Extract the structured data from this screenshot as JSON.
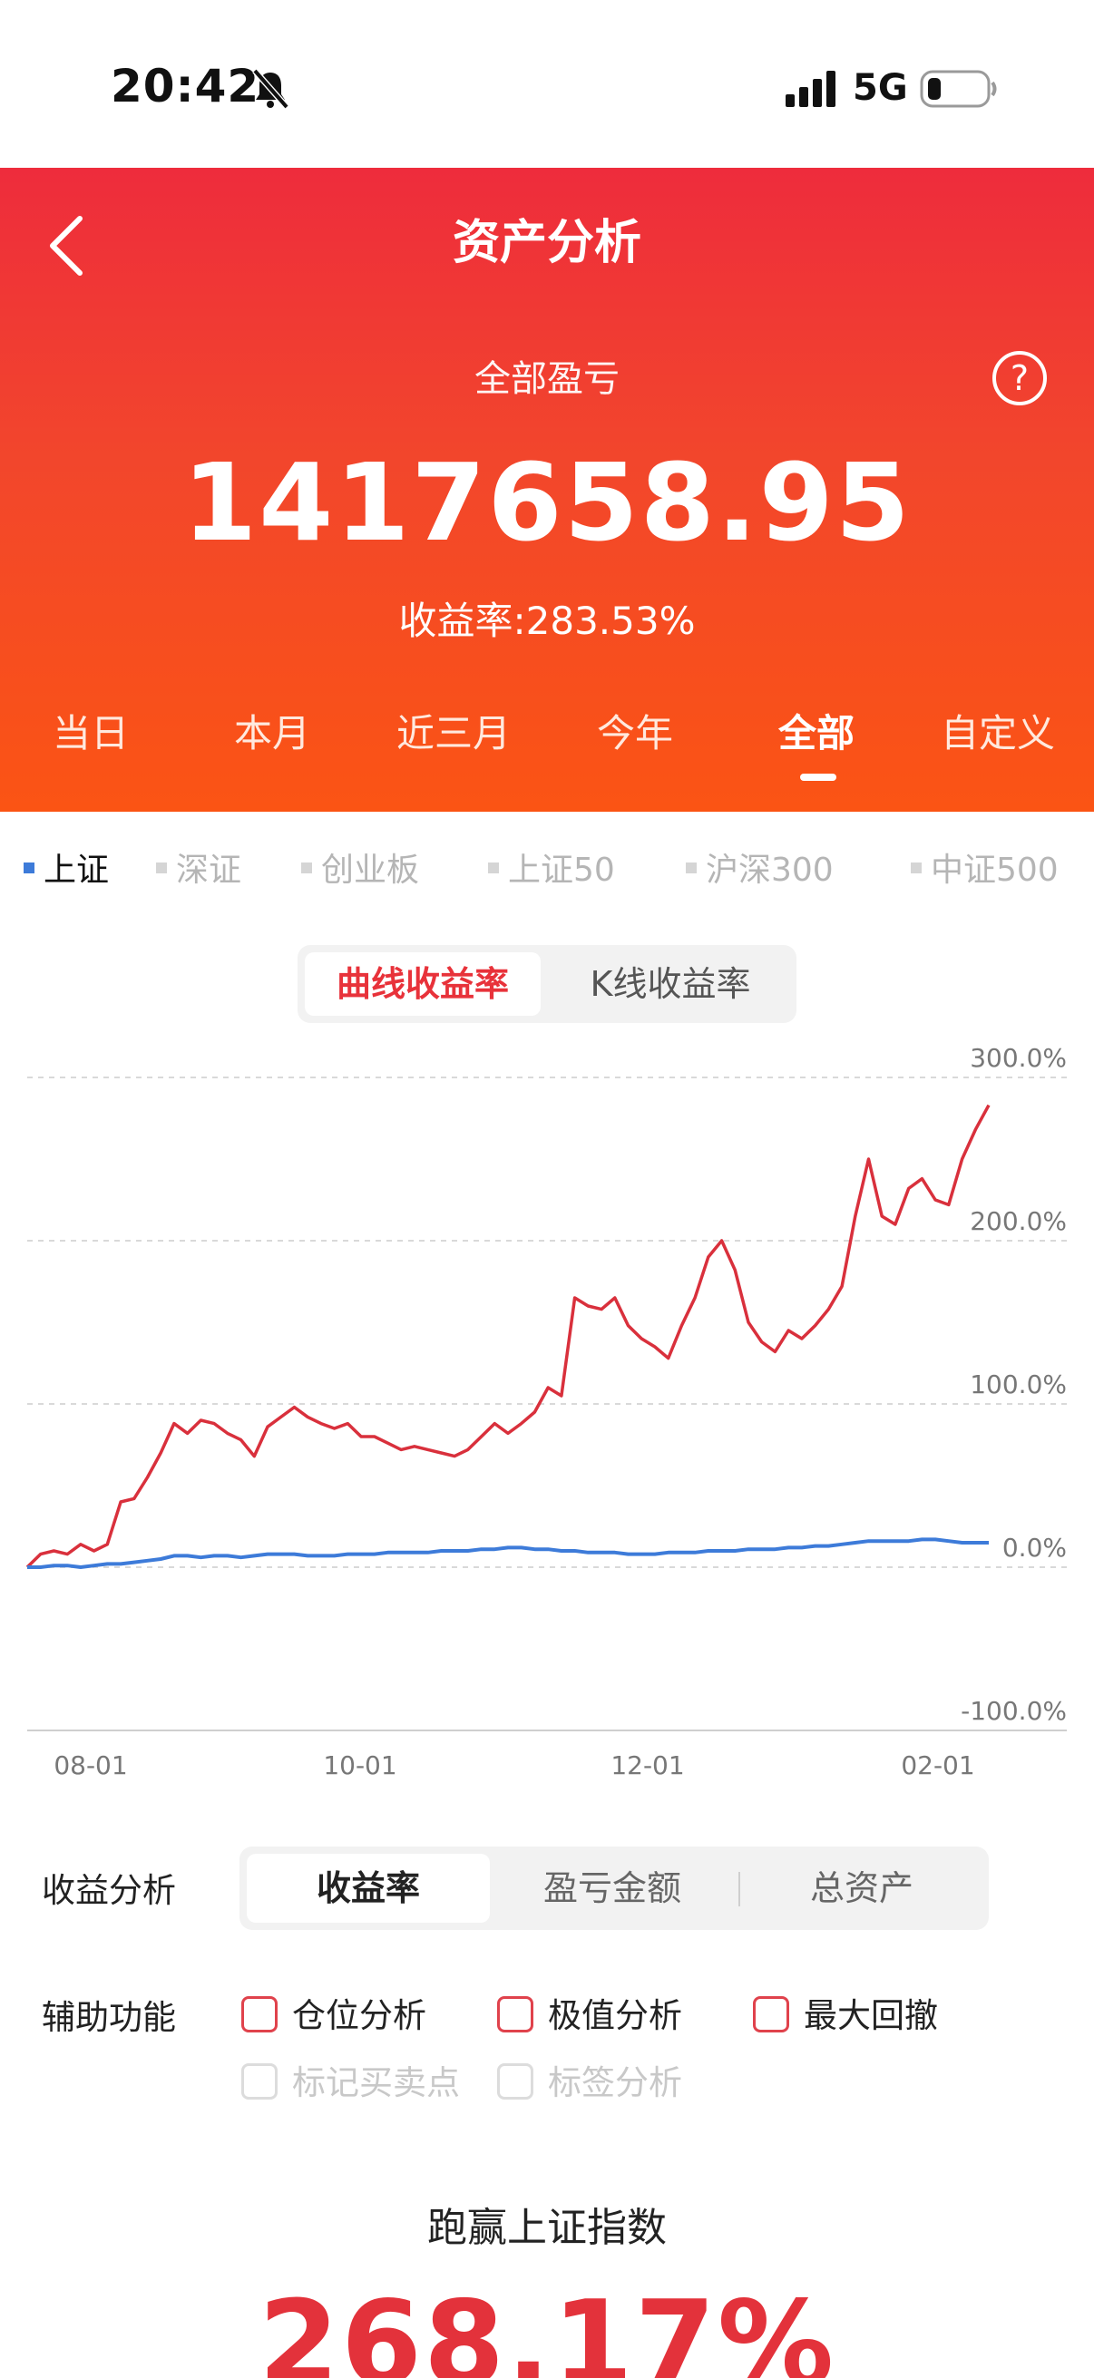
{
  "status_bar": {
    "time": "20:42",
    "network": "5G"
  },
  "header": {
    "title": "资产分析",
    "total_label": "全部盈亏",
    "total_value": "1417658.95",
    "yield_label": "收益率:",
    "yield_value": "283.53%",
    "period_tabs": [
      {
        "label": "当日"
      },
      {
        "label": "本月"
      },
      {
        "label": "近三月"
      },
      {
        "label": "今年"
      },
      {
        "label": "全部",
        "active": true
      },
      {
        "label": "自定义"
      }
    ]
  },
  "index_selector": [
    {
      "label": "上证",
      "active": true
    },
    {
      "label": "深证"
    },
    {
      "label": "创业板"
    },
    {
      "label": "上证50"
    },
    {
      "label": "沪深300"
    },
    {
      "label": "中证500"
    }
  ],
  "chart_toggle": {
    "curve": "曲线收益率",
    "kline": "K线收益率",
    "selected": "curve"
  },
  "chart_data": {
    "type": "line",
    "title": "",
    "ylim": [
      -100,
      300
    ],
    "y_ticks": [
      "300.0%",
      "200.0%",
      "100.0%",
      "0.0%",
      "-100.0%"
    ],
    "x_ticks": [
      "08-01",
      "10-01",
      "12-01",
      "02-01"
    ],
    "grid": true,
    "series": [
      {
        "color": "#d9303c",
        "values": [
          0,
          8,
          10,
          8,
          14,
          10,
          14,
          40,
          42,
          55,
          70,
          88,
          82,
          90,
          88,
          82,
          78,
          68,
          86,
          92,
          98,
          92,
          88,
          85,
          88,
          80,
          80,
          76,
          72,
          74,
          72,
          70,
          68,
          72,
          80,
          88,
          82,
          88,
          95,
          110,
          105,
          165,
          160,
          158,
          165,
          148,
          140,
          135,
          128,
          148,
          165,
          190,
          200,
          182,
          150,
          138,
          132,
          145,
          140,
          148,
          158,
          172,
          215,
          250,
          215,
          210,
          232,
          238,
          225,
          222,
          250,
          268,
          283
        ]
      },
      {
        "color": "#3d7bd9",
        "values": [
          0,
          0,
          1,
          1,
          0,
          1,
          2,
          2,
          3,
          4,
          5,
          7,
          7,
          6,
          7,
          7,
          6,
          7,
          8,
          8,
          8,
          7,
          7,
          7,
          8,
          8,
          8,
          9,
          9,
          9,
          9,
          10,
          10,
          10,
          11,
          11,
          12,
          12,
          11,
          11,
          10,
          10,
          9,
          9,
          9,
          8,
          8,
          8,
          9,
          9,
          9,
          10,
          10,
          10,
          11,
          11,
          11,
          12,
          12,
          13,
          13,
          14,
          15,
          16,
          16,
          16,
          16,
          17,
          17,
          16,
          15,
          15,
          15
        ]
      }
    ]
  },
  "analysis": {
    "label": "收益分析",
    "metrics": [
      {
        "label": "收益率",
        "active": true
      },
      {
        "label": "盈亏金额"
      },
      {
        "label": "总资产"
      }
    ]
  },
  "aux": {
    "label": "辅助功能",
    "options": [
      {
        "label": "仓位分析",
        "enabled": true
      },
      {
        "label": "极值分析",
        "enabled": true
      },
      {
        "label": "最大回撤",
        "enabled": true
      },
      {
        "label": "标记买卖点",
        "enabled": false
      },
      {
        "label": "标签分析",
        "enabled": false
      }
    ]
  },
  "beat": {
    "label": "跑赢上证指数",
    "value": "268.17%"
  }
}
